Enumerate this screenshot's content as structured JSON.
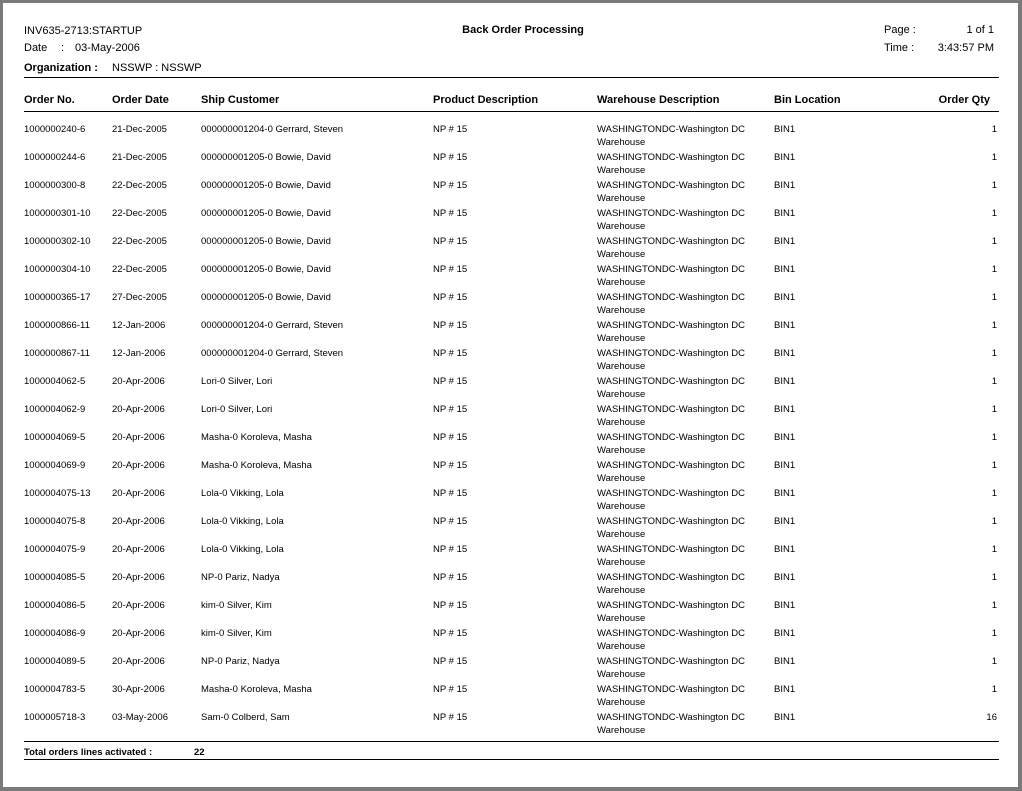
{
  "header": {
    "report_id": "INV635-2713:STARTUP",
    "date_label": "Date",
    "date_sep": ":",
    "date_value": "03-May-2006",
    "title": "Back Order Processing",
    "page_label": "Page :",
    "page_value": "1 of 1",
    "time_label": "Time :",
    "time_value": "3:43:57 PM",
    "org_label": "Organization :",
    "org_value": "NSSWP : NSSWP"
  },
  "columns": {
    "order_no": "Order No.",
    "order_date": "Order Date",
    "ship_customer": "Ship Customer",
    "product": "Product Description",
    "warehouse": "Warehouse Description",
    "bin": "Bin Location",
    "qty": "Order Qty"
  },
  "rows": [
    {
      "order_no": "1000000240-6",
      "order_date": "21-Dec-2005",
      "ship_customer": "000000001204-0 Gerrard, Steven",
      "product": "NP # 15",
      "warehouse": "WASHINGTONDC-Washington DC Warehouse",
      "bin": "BIN1",
      "qty": "1"
    },
    {
      "order_no": "1000000244-6",
      "order_date": "21-Dec-2005",
      "ship_customer": "000000001205-0 Bowie, David",
      "product": "NP # 15",
      "warehouse": "WASHINGTONDC-Washington DC Warehouse",
      "bin": "BIN1",
      "qty": "1"
    },
    {
      "order_no": "1000000300-8",
      "order_date": "22-Dec-2005",
      "ship_customer": "000000001205-0 Bowie, David",
      "product": "NP # 15",
      "warehouse": "WASHINGTONDC-Washington DC Warehouse",
      "bin": "BIN1",
      "qty": "1"
    },
    {
      "order_no": "1000000301-10",
      "order_date": "22-Dec-2005",
      "ship_customer": "000000001205-0 Bowie, David",
      "product": "NP # 15",
      "warehouse": "WASHINGTONDC-Washington DC Warehouse",
      "bin": "BIN1",
      "qty": "1"
    },
    {
      "order_no": "1000000302-10",
      "order_date": "22-Dec-2005",
      "ship_customer": "000000001205-0 Bowie, David",
      "product": "NP # 15",
      "warehouse": "WASHINGTONDC-Washington DC Warehouse",
      "bin": "BIN1",
      "qty": "1"
    },
    {
      "order_no": "1000000304-10",
      "order_date": "22-Dec-2005",
      "ship_customer": "000000001205-0 Bowie, David",
      "product": "NP # 15",
      "warehouse": "WASHINGTONDC-Washington DC Warehouse",
      "bin": "BIN1",
      "qty": "1"
    },
    {
      "order_no": "1000000365-17",
      "order_date": "27-Dec-2005",
      "ship_customer": "000000001205-0 Bowie, David",
      "product": "NP # 15",
      "warehouse": "WASHINGTONDC-Washington DC Warehouse",
      "bin": "BIN1",
      "qty": "1"
    },
    {
      "order_no": "1000000866-11",
      "order_date": "12-Jan-2006",
      "ship_customer": "000000001204-0 Gerrard, Steven",
      "product": "NP # 15",
      "warehouse": "WASHINGTONDC-Washington DC Warehouse",
      "bin": "BIN1",
      "qty": "1"
    },
    {
      "order_no": "1000000867-11",
      "order_date": "12-Jan-2006",
      "ship_customer": "000000001204-0 Gerrard, Steven",
      "product": "NP # 15",
      "warehouse": "WASHINGTONDC-Washington DC Warehouse",
      "bin": "BIN1",
      "qty": "1"
    },
    {
      "order_no": "1000004062-5",
      "order_date": "20-Apr-2006",
      "ship_customer": "Lori-0 Silver, Lori",
      "product": "NP # 15",
      "warehouse": "WASHINGTONDC-Washington DC Warehouse",
      "bin": "BIN1",
      "qty": "1"
    },
    {
      "order_no": "1000004062-9",
      "order_date": "20-Apr-2006",
      "ship_customer": "Lori-0 Silver, Lori",
      "product": "NP # 15",
      "warehouse": "WASHINGTONDC-Washington DC Warehouse",
      "bin": "BIN1",
      "qty": "1"
    },
    {
      "order_no": "1000004069-5",
      "order_date": "20-Apr-2006",
      "ship_customer": "Masha-0 Koroleva, Masha",
      "product": "NP # 15",
      "warehouse": "WASHINGTONDC-Washington DC Warehouse",
      "bin": "BIN1",
      "qty": "1"
    },
    {
      "order_no": "1000004069-9",
      "order_date": "20-Apr-2006",
      "ship_customer": "Masha-0 Koroleva, Masha",
      "product": "NP # 15",
      "warehouse": "WASHINGTONDC-Washington DC Warehouse",
      "bin": "BIN1",
      "qty": "1"
    },
    {
      "order_no": "1000004075-13",
      "order_date": "20-Apr-2006",
      "ship_customer": "Lola-0 Vikking, Lola",
      "product": "NP # 15",
      "warehouse": "WASHINGTONDC-Washington DC Warehouse",
      "bin": "BIN1",
      "qty": "1"
    },
    {
      "order_no": "1000004075-8",
      "order_date": "20-Apr-2006",
      "ship_customer": "Lola-0 Vikking, Lola",
      "product": "NP # 15",
      "warehouse": "WASHINGTONDC-Washington DC Warehouse",
      "bin": "BIN1",
      "qty": "1"
    },
    {
      "order_no": "1000004075-9",
      "order_date": "20-Apr-2006",
      "ship_customer": "Lola-0 Vikking, Lola",
      "product": "NP # 15",
      "warehouse": "WASHINGTONDC-Washington DC Warehouse",
      "bin": "BIN1",
      "qty": "1"
    },
    {
      "order_no": "1000004085-5",
      "order_date": "20-Apr-2006",
      "ship_customer": "NP-0 Pariz, Nadya",
      "product": "NP # 15",
      "warehouse": "WASHINGTONDC-Washington DC Warehouse",
      "bin": "BIN1",
      "qty": "1"
    },
    {
      "order_no": "1000004086-5",
      "order_date": "20-Apr-2006",
      "ship_customer": "kim-0 Silver, Kim",
      "product": "NP # 15",
      "warehouse": "WASHINGTONDC-Washington DC Warehouse",
      "bin": "BIN1",
      "qty": "1"
    },
    {
      "order_no": "1000004086-9",
      "order_date": "20-Apr-2006",
      "ship_customer": "kim-0 Silver, Kim",
      "product": "NP # 15",
      "warehouse": "WASHINGTONDC-Washington DC Warehouse",
      "bin": "BIN1",
      "qty": "1"
    },
    {
      "order_no": "1000004089-5",
      "order_date": "20-Apr-2006",
      "ship_customer": "NP-0 Pariz, Nadya",
      "product": "NP # 15",
      "warehouse": "WASHINGTONDC-Washington DC Warehouse",
      "bin": "BIN1",
      "qty": "1"
    },
    {
      "order_no": "1000004783-5",
      "order_date": "30-Apr-2006",
      "ship_customer": "Masha-0 Koroleva, Masha",
      "product": "NP # 15",
      "warehouse": "WASHINGTONDC-Washington DC Warehouse",
      "bin": "BIN1",
      "qty": "1"
    },
    {
      "order_no": "1000005718-3",
      "order_date": "03-May-2006",
      "ship_customer": "Sam-0 Colberd, Sam",
      "product": "NP # 15",
      "warehouse": "WASHINGTONDC-Washington DC Warehouse",
      "bin": "BIN1",
      "qty": "16"
    }
  ],
  "footer": {
    "label": "Total orders lines activated :",
    "value": "22"
  }
}
